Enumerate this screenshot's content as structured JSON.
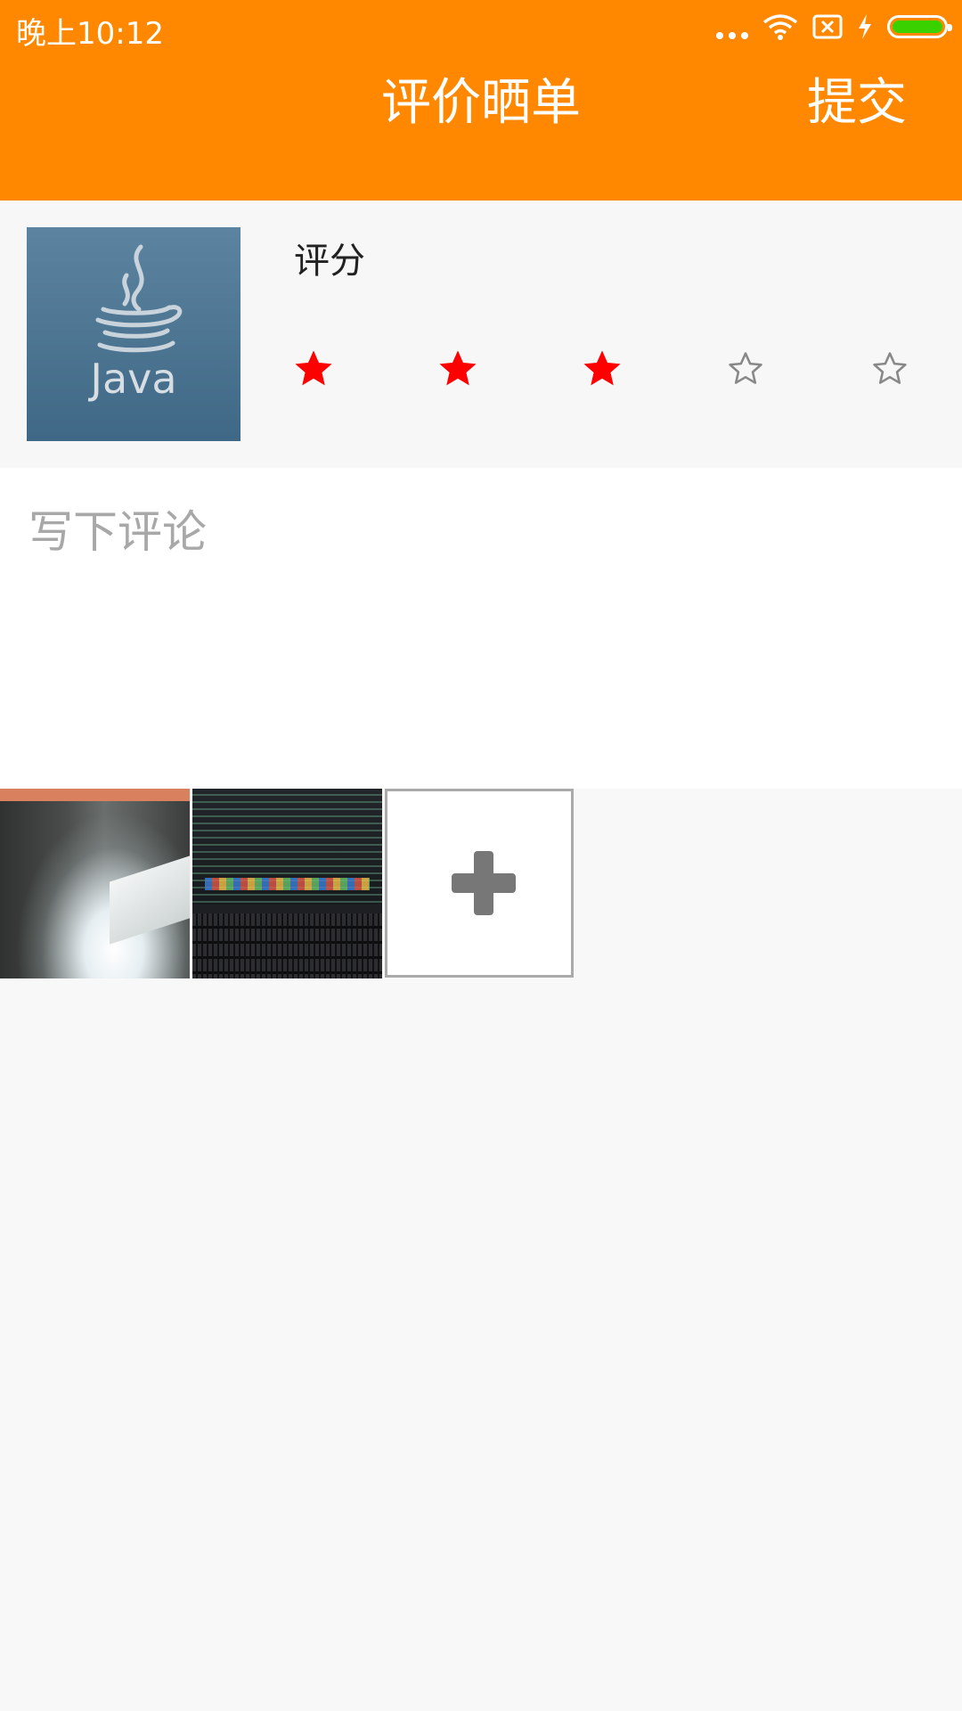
{
  "status_bar": {
    "time": "晚上10:12",
    "icons": [
      "more-dots-icon",
      "wifi-icon",
      "sim-off-icon",
      "charging-icon",
      "battery-icon"
    ],
    "battery_color": "#3ad100"
  },
  "header": {
    "title": "评价晒单",
    "submit_label": "提交",
    "background": "#ff8800"
  },
  "product": {
    "image_icon": "java-logo",
    "image_text": "Java",
    "rating_label": "评分",
    "rating": 3,
    "max_rating": 5,
    "star_active_color": "#ff0000",
    "star_inactive_color": "#888888"
  },
  "comment": {
    "placeholder": "写下评论",
    "value": ""
  },
  "photos": {
    "count": 2,
    "add_icon": "plus-icon"
  }
}
